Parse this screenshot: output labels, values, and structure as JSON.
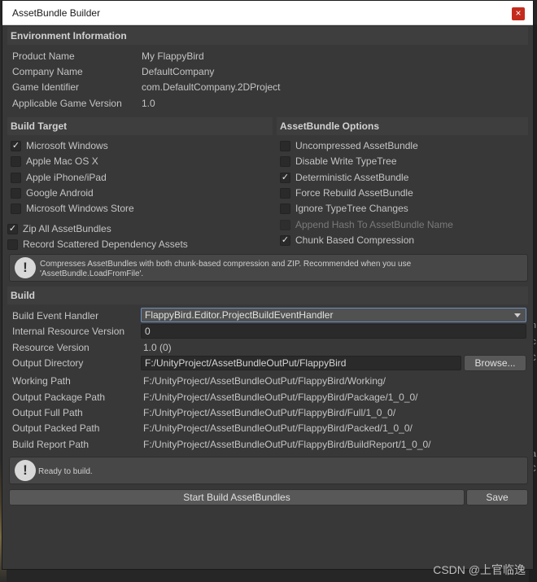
{
  "window": {
    "title": "AssetBundle Builder",
    "close_symbol": "×"
  },
  "environment": {
    "header": "Environment Information",
    "rows": [
      {
        "label": "Product Name",
        "value": "My FlappyBird"
      },
      {
        "label": "Company Name",
        "value": "DefaultCompany"
      },
      {
        "label": "Game Identifier",
        "value": "com.DefaultCompany.2DProject"
      },
      {
        "label": "Applicable Game Version",
        "value": "1.0"
      }
    ]
  },
  "build_target": {
    "header": "Build Target",
    "platforms": [
      {
        "label": "Microsoft Windows",
        "checked": true
      },
      {
        "label": "Apple Mac OS X",
        "checked": false
      },
      {
        "label": "Apple iPhone/iPad",
        "checked": false
      },
      {
        "label": "Google Android",
        "checked": false
      },
      {
        "label": "Microsoft Windows Store",
        "checked": false
      }
    ],
    "zip_all": {
      "label": "Zip All AssetBundles",
      "checked": true
    },
    "record_scattered": {
      "label": "Record Scattered Dependency Assets",
      "checked": false
    }
  },
  "assetbundle_options": {
    "header": "AssetBundle Options",
    "options": [
      {
        "label": "Uncompressed AssetBundle",
        "checked": false,
        "disabled": false
      },
      {
        "label": "Disable Write TypeTree",
        "checked": false,
        "disabled": false
      },
      {
        "label": "Deterministic AssetBundle",
        "checked": true,
        "disabled": false
      },
      {
        "label": "Force Rebuild AssetBundle",
        "checked": false,
        "disabled": false
      },
      {
        "label": "Ignore TypeTree Changes",
        "checked": false,
        "disabled": false
      },
      {
        "label": "Append Hash To AssetBundle Name",
        "checked": false,
        "disabled": true
      },
      {
        "label": "Chunk Based Compression",
        "checked": true,
        "disabled": false
      }
    ]
  },
  "compression_help": {
    "line1": "Compresses AssetBundles with both chunk-based compression and ZIP. Recommended when you use",
    "line2": "'AssetBundle.LoadFromFile'."
  },
  "build": {
    "header": "Build",
    "event_handler_label": "Build Event Handler",
    "event_handler_value": "FlappyBird.Editor.ProjectBuildEventHandler",
    "internal_version_label": "Internal Resource Version",
    "internal_version_value": "0",
    "resource_version_label": "Resource Version",
    "resource_version_value": "1.0 (0)",
    "output_dir_label": "Output Directory",
    "output_dir_value": "F:/UnityProject/AssetBundleOutPut/FlappyBird",
    "browse_label": "Browse...",
    "paths": [
      {
        "label": "Working Path",
        "value": "F:/UnityProject/AssetBundleOutPut/FlappyBird/Working/"
      },
      {
        "label": "Output Package Path",
        "value": "F:/UnityProject/AssetBundleOutPut/FlappyBird/Package/1_0_0/"
      },
      {
        "label": "Output Full Path",
        "value": "F:/UnityProject/AssetBundleOutPut/FlappyBird/Full/1_0_0/"
      },
      {
        "label": "Output Packed Path",
        "value": "F:/UnityProject/AssetBundleOutPut/FlappyBird/Packed/1_0_0/"
      },
      {
        "label": "Build Report Path",
        "value": "F:/UnityProject/AssetBundleOutPut/FlappyBird/BuildReport/1_0_0/"
      }
    ]
  },
  "status": {
    "message": "Ready to build."
  },
  "actions": {
    "start_build_label": "Start Build AssetBundles",
    "save_label": "Save"
  },
  "watermark": "CSDN @上官临逸",
  "background_glyphs": [
    "in",
    "ic",
    "C",
    "na",
    "C"
  ],
  "icons": {
    "info": "!",
    "check": "✓"
  }
}
